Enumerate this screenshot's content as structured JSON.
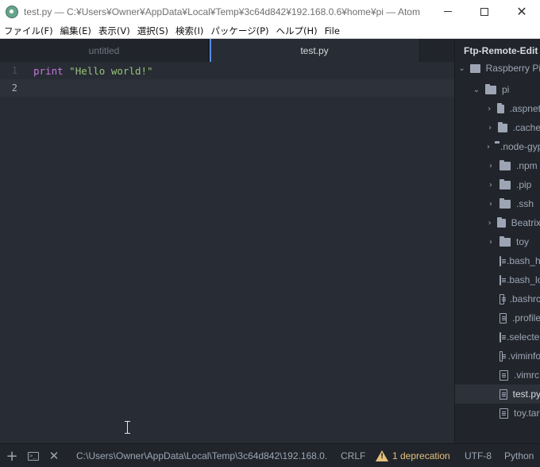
{
  "window": {
    "title": "test.py — C:¥Users¥Owner¥AppData¥Local¥Temp¥3c64d842¥192.168.0.6¥home¥pi — Atom"
  },
  "menu": [
    "ファイル(F)",
    "編集(E)",
    "表示(V)",
    "選択(S)",
    "検索(I)",
    "パッケージ(P)",
    "ヘルプ(H)",
    "File"
  ],
  "tabs": [
    {
      "label": "untitled",
      "active": false
    },
    {
      "label": "test.py",
      "active": true
    }
  ],
  "editor": {
    "lines": [
      {
        "number": "1",
        "keyword": "print",
        "text": " ",
        "string": "\"Hello world!\""
      },
      {
        "number": "2",
        "keyword": "",
        "text": "",
        "string": ""
      }
    ],
    "colors": {
      "keyword": "#c678dd",
      "string": "#98c379",
      "background": "#282c34"
    }
  },
  "panel": {
    "title": "Ftp-Remote-Edit",
    "root": {
      "label": "Raspberry Pi",
      "icon": "repo-icon",
      "expanded": true
    },
    "home": {
      "label": "pi",
      "icon": "folder-icon",
      "expanded": true
    },
    "folders": [
      ".aspnet",
      ".cache",
      ".node-gyp",
      ".npm",
      ".pip",
      ".ssh",
      "Beatrix",
      "toy"
    ],
    "files": [
      ".bash_history",
      ".bash_logout",
      ".bashrc",
      ".profile",
      ".selected_editor",
      ".viminfo",
      ".vimrc",
      "test.py",
      "toy.tar"
    ],
    "selected_file": "test.py"
  },
  "status": {
    "path": "C:\\Users\\Owner\\AppData\\Local\\Temp\\3c64d842\\192.168.0.",
    "line_ending": "CRLF",
    "deprecation": "1 deprecation",
    "encoding": "UTF-8",
    "grammar": "Python",
    "warn_color": "#e5c07b",
    "terminal_glyph": ">_"
  }
}
